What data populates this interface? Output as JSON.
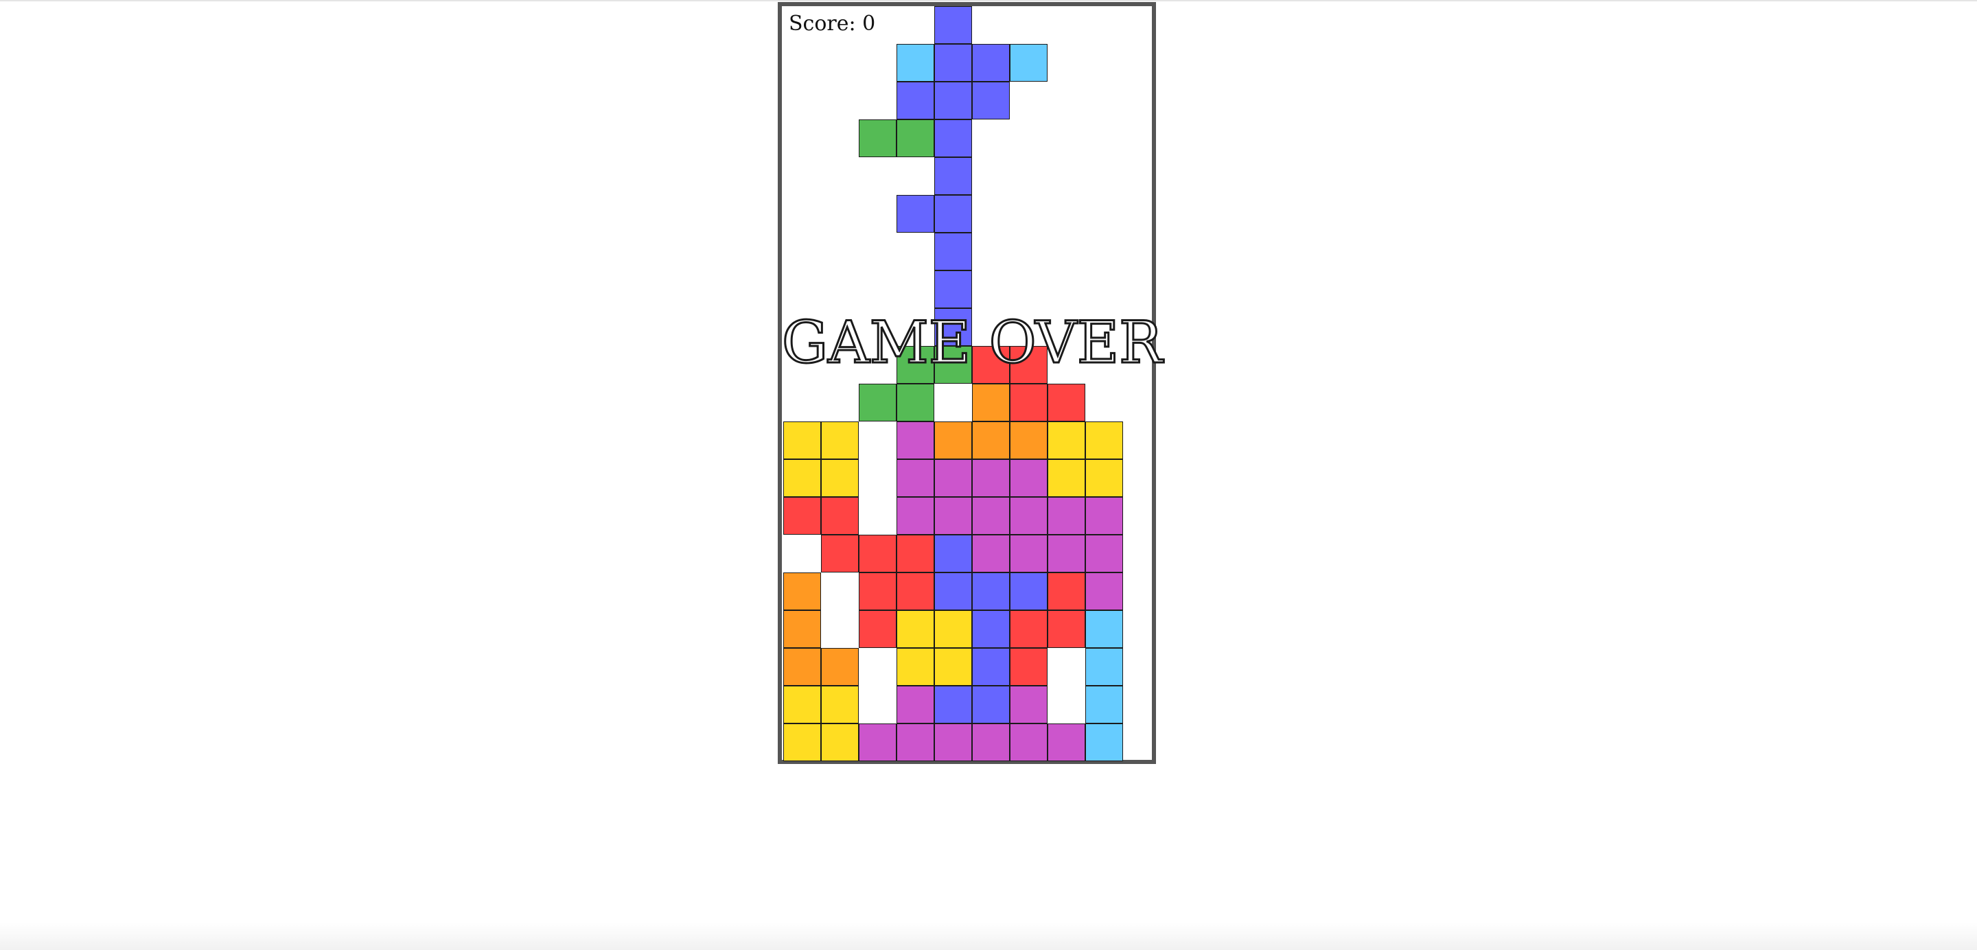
{
  "game": {
    "score_text": "Score: 0",
    "game_over_text": "GAME OVER",
    "board_columns": 9,
    "board_rows": 20,
    "colors": {
      "C": "#66ccff",
      "B": "#6666ff",
      "G": "#55bb55",
      "R": "#ff4444",
      "O": "#ff9922",
      "Y": "#ffdd22",
      "P": "#cc55cc"
    },
    "grid": [
      "....B....",
      "...CBBC..",
      "...BBB...",
      "..GGB....",
      "....B....",
      "...BB....",
      "....B....",
      "....B....",
      "....B....",
      "...GGRR..",
      "..GG.ORR.",
      "YY.POOOYY",
      "YY.PPPPYY",
      "RR.PPPPPP",
      ".RRRBPPPP",
      "O.RRBBBRP",
      "O.RYYBRRC",
      "OO.YYBR.C",
      "YY.PBBP.C",
      "YYPPPPPPC"
    ]
  }
}
